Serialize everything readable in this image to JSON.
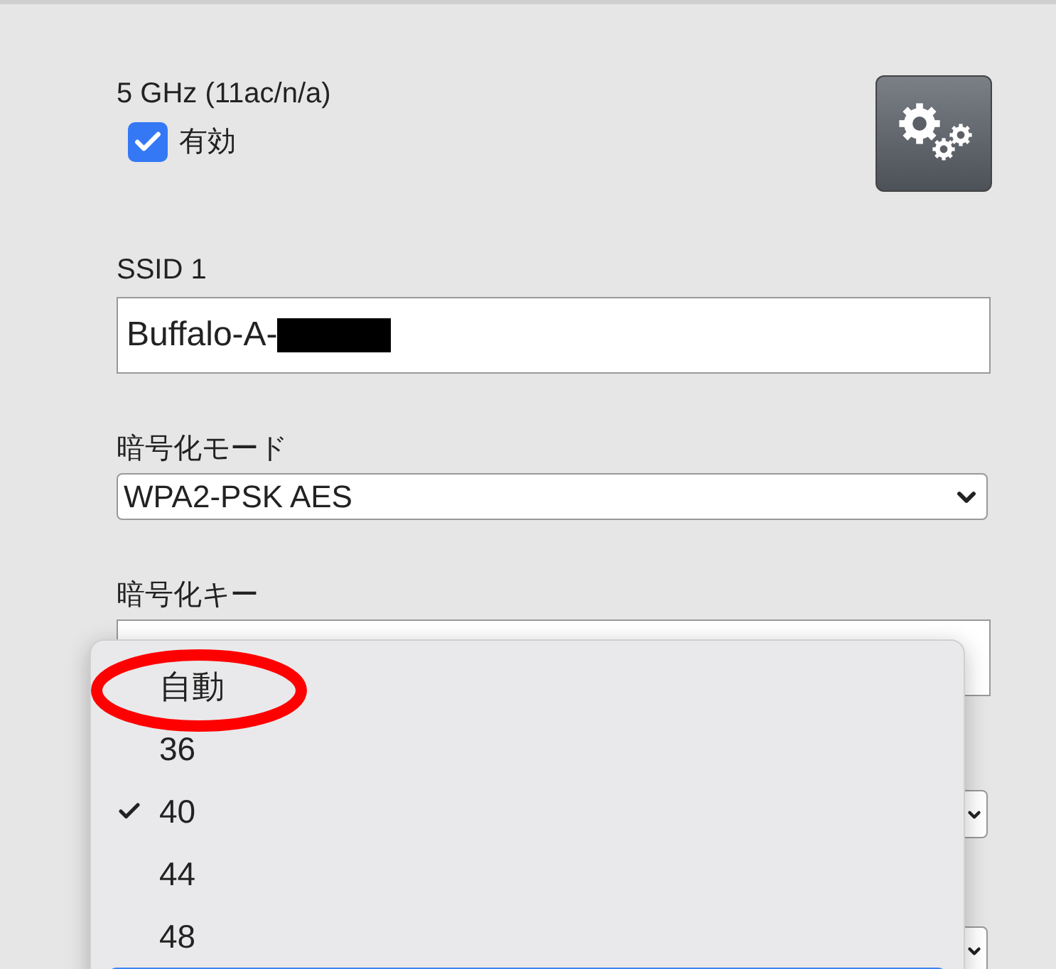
{
  "band": {
    "title": "5 GHz (11ac/n/a)",
    "enabled": {
      "label": "有効",
      "checked": true
    }
  },
  "ssid": {
    "label": "SSID 1",
    "value": "Buffalo-A-"
  },
  "encryption_mode": {
    "label": "暗号化モード",
    "value": "WPA2-PSK AES"
  },
  "encryption_key": {
    "label": "暗号化キー"
  },
  "channel_menu": {
    "items": [
      {
        "label": "自動",
        "selected": false,
        "highlighted": false,
        "circled": true
      },
      {
        "label": "36",
        "selected": false,
        "highlighted": false,
        "circled": false
      },
      {
        "label": "40",
        "selected": true,
        "highlighted": false,
        "circled": false
      },
      {
        "label": "44",
        "selected": false,
        "highlighted": false,
        "circled": false
      },
      {
        "label": "48",
        "selected": false,
        "highlighted": false,
        "circled": false
      },
      {
        "highlighted": true,
        "circled": false
      }
    ]
  }
}
